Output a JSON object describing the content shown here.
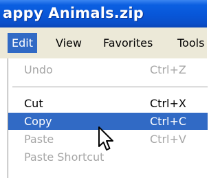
{
  "window": {
    "title": "appy Animals.zip"
  },
  "menubar": {
    "items": [
      {
        "label": "Edit",
        "active": true
      },
      {
        "label": "View"
      },
      {
        "label": "Favorites"
      },
      {
        "label": "Tools"
      }
    ]
  },
  "edit_menu": {
    "items": [
      {
        "label": "Undo",
        "shortcut": "Ctrl+Z",
        "enabled": false
      },
      {
        "label": "Cut",
        "shortcut": "Ctrl+X",
        "enabled": true
      },
      {
        "label": "Copy",
        "shortcut": "Ctrl+C",
        "enabled": true,
        "highlighted": true
      },
      {
        "label": "Paste",
        "shortcut": "Ctrl+V",
        "enabled": false
      },
      {
        "label": "Paste Shortcut",
        "shortcut": "",
        "enabled": false
      }
    ]
  },
  "cursor": {
    "icon": "arrow-pointer-icon"
  },
  "colors": {
    "titlebar": "#0856d8",
    "selection": "#316ac5",
    "menubar": "#ece9d8",
    "disabled_text": "#a6a6a6"
  }
}
